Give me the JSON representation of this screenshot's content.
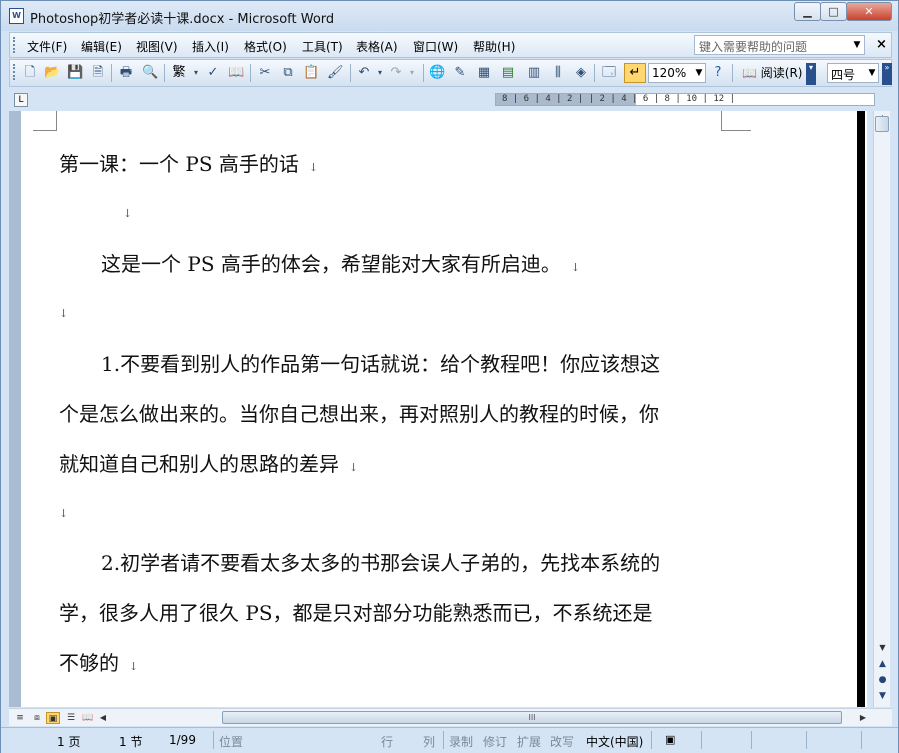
{
  "window": {
    "title": "Photoshop初学者必读十课.docx - Microsoft Word",
    "app_icon": "word-doc-icon",
    "minimize": "▁",
    "maximize": "□",
    "close": "✕"
  },
  "menubar": {
    "items": [
      "文件(F)",
      "编辑(E)",
      "视图(V)",
      "插入(I)",
      "格式(O)",
      "工具(T)",
      "表格(A)",
      "窗口(W)",
      "帮助(H)"
    ],
    "help_placeholder": "键入需要帮助的问题",
    "close": "×"
  },
  "toolbar": {
    "traditional": "繁",
    "zoom": "120%",
    "read_label": "阅读(R)",
    "font_size": "四号"
  },
  "ruler": {
    "numbers": "8 | 6 | 4 | 2 |   | 2 | 4 | 6 | 8 | 10 | 12 |"
  },
  "document": {
    "paragraph_mark": "↓",
    "lines": [
      "第一课：一个 PS 高手的话",
      "",
      "这是一个 PS 高手的体会，希望能对大家有所启迪。",
      "",
      "1.不要看到别人的作品第一句话就说：给个教程吧！你应该想这",
      "个是怎么做出来的。当你自己想出来，再对照别人的教程的时候，你",
      "就知道自己和别人的思路的差异",
      "",
      "2.初学者请不要看太多太多的书那会误人子弟的，先找本系统的",
      "学，很多人用了很久 PS，都是只对部分功能熟悉而已，不系统还是",
      "不够的"
    ]
  },
  "hscroll": {
    "thumb_grip": "III"
  },
  "statusbar": {
    "page": "1 页",
    "section": "1 节",
    "page_of": "1/99",
    "position": "位置",
    "line": "行",
    "column": "列",
    "record": "录制",
    "revise": "修订",
    "extend": "扩展",
    "overtype": "改写",
    "language": "中文(中国)"
  }
}
